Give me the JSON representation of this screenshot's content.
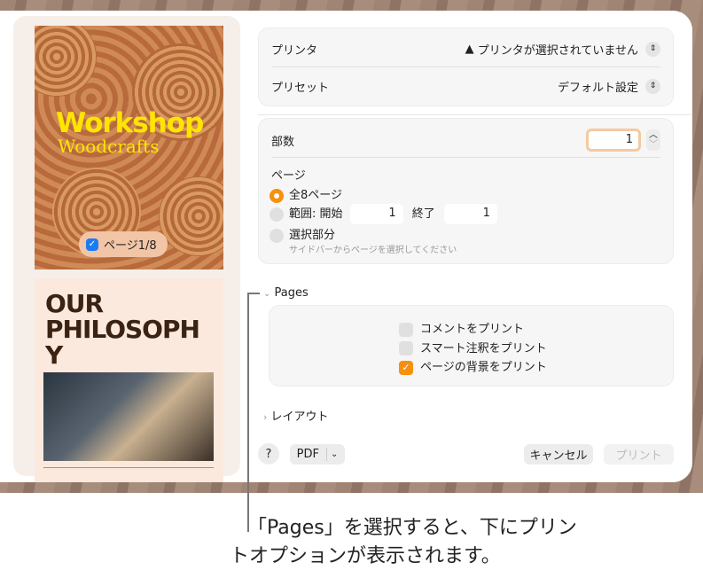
{
  "preview": {
    "page1_title": "Workshop",
    "page1_subtitle": "Woodcrafts",
    "page_badge": "ページ1/8",
    "page2_title": "OUR PHILOSOPHY",
    "page2_title_lines": [
      "OUR",
      "PHILOSOPH",
      "Y"
    ]
  },
  "printer": {
    "label": "プリンタ",
    "value": "プリンタが選択されていません",
    "preset_label": "プリセット",
    "preset_value": "デフォルト設定"
  },
  "copies": {
    "label": "部数",
    "value": "1"
  },
  "pages": {
    "label": "ページ",
    "all": "全8ページ",
    "range_label": "範囲: 開始",
    "range_from": "1",
    "range_to_label": "終了",
    "range_to": "1",
    "selection": "選択部分",
    "selection_hint": "サイドバーからページを選択してください"
  },
  "pages_section": {
    "title": "Pages",
    "options": [
      {
        "label": "コメントをプリント",
        "checked": false
      },
      {
        "label": "スマート注釈をプリント",
        "checked": false
      },
      {
        "label": "ページの背景をプリント",
        "checked": true
      }
    ]
  },
  "layout_section": {
    "title": "レイアウト"
  },
  "footer": {
    "help": "?",
    "pdf": "PDF",
    "cancel": "キャンセル",
    "print": "プリント"
  },
  "callout": {
    "line1": "「Pages」を選択すると、下にプリン",
    "line2": "トオプションが表示されます。"
  },
  "colors": {
    "accent": "#f7900f",
    "text": "#222222"
  }
}
